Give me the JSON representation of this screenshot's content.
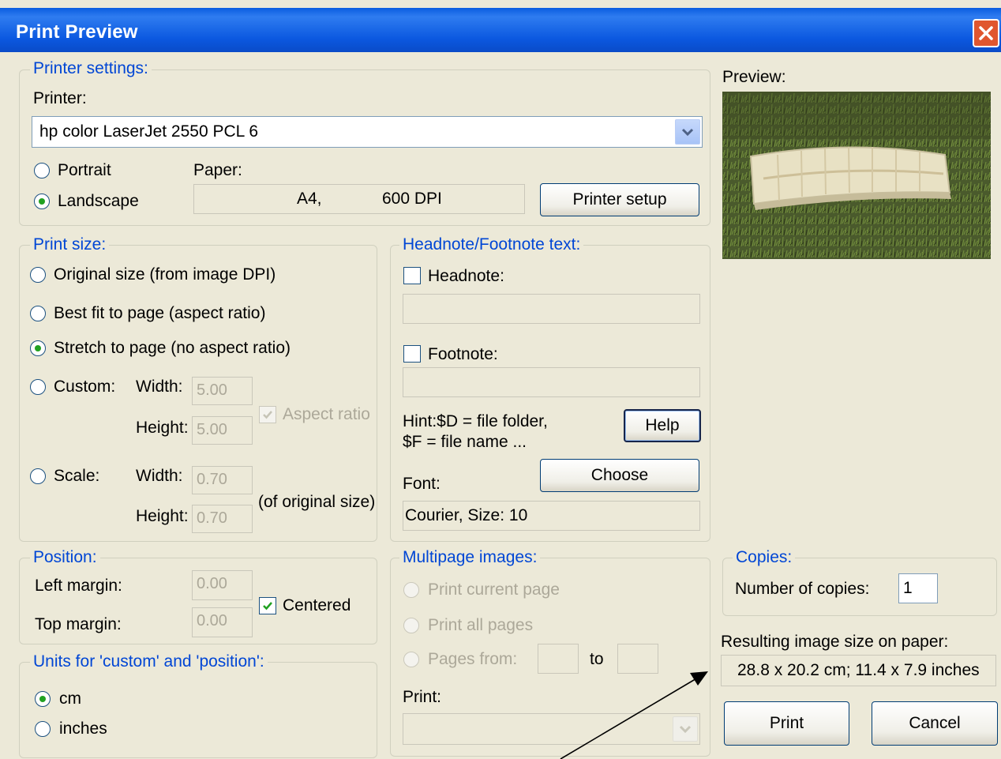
{
  "window": {
    "title": "Print Preview"
  },
  "printer_settings": {
    "legend": "Printer settings:",
    "printer_label": "Printer:",
    "printer_value": "hp color LaserJet 2550 PCL 6",
    "orientation_portrait": "Portrait",
    "orientation_landscape": "Landscape",
    "selected_orientation": "Landscape",
    "paper_label": "Paper:",
    "paper_size": "A4,",
    "paper_dpi": "600 DPI",
    "printer_setup_button": "Printer setup"
  },
  "print_size": {
    "legend": "Print size:",
    "options": [
      "Original size (from image DPI)",
      "Best fit to page (aspect ratio)",
      "Stretch to page (no aspect ratio)",
      "Custom:",
      "Scale:"
    ],
    "selected": "Stretch to page (no aspect ratio)",
    "width_label": "Width:",
    "height_label": "Height:",
    "custom_width": "5.00",
    "custom_height": "5.00",
    "aspect_ratio_label": "Aspect ratio",
    "scale_width": "0.70",
    "scale_height": "0.70",
    "of_original_label": "(of original size)"
  },
  "headnote": {
    "legend": "Headnote/Footnote text:",
    "headnote_label": "Headnote:",
    "headnote_value": "",
    "footnote_label": "Footnote:",
    "footnote_value": "",
    "hint_line1": "Hint:$D = file folder,",
    "hint_line2": "$F = file name ...",
    "help_button": "Help",
    "font_label": "Font:",
    "choose_button": "Choose",
    "font_value": "Courier, Size: 10"
  },
  "preview": {
    "label": "Preview:"
  },
  "position": {
    "legend": "Position:",
    "left_margin_label": "Left margin:",
    "left_margin_value": "0.00",
    "top_margin_label": "Top margin:",
    "top_margin_value": "0.00",
    "centered_label": "Centered"
  },
  "units": {
    "legend": "Units for 'custom' and 'position':",
    "cm_label": "cm",
    "inches_label": "inches",
    "selected": "cm"
  },
  "multipage": {
    "legend": "Multipage images:",
    "current_page": "Print current page",
    "all_pages": "Print all pages",
    "pages_from": "Pages from:",
    "to_label": "to",
    "from_value": "",
    "to_value": "",
    "print_label": "Print:",
    "print_value": ""
  },
  "copies": {
    "legend": "Copies:",
    "number_label": "Number of copies:",
    "number_value": "1"
  },
  "result": {
    "label": "Resulting image size on paper:",
    "value": "28.8 x 20.2 cm; 11.4 x 7.9 inches"
  },
  "buttons": {
    "print": "Print",
    "cancel": "Cancel"
  }
}
